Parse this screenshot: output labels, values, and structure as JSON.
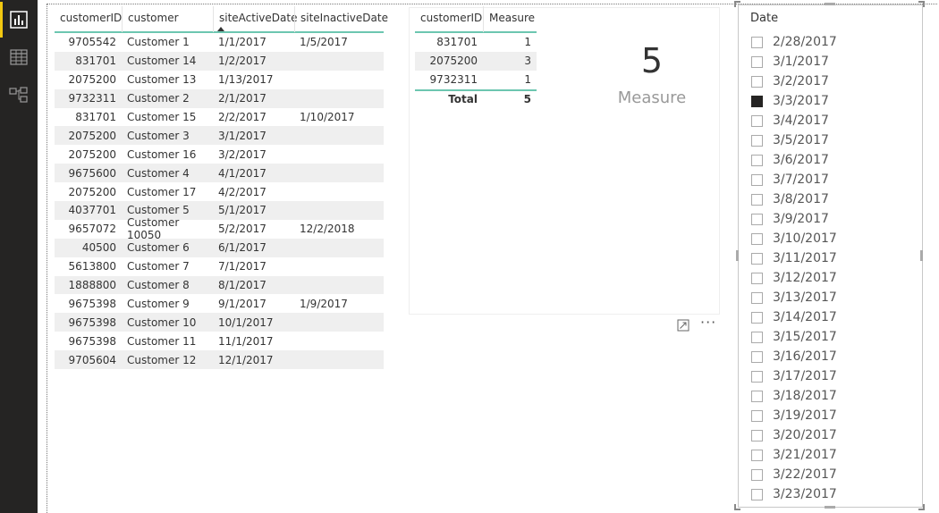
{
  "rail": {
    "items": [
      {
        "name": "report-view-icon",
        "active": true
      },
      {
        "name": "data-view-icon",
        "active": false
      },
      {
        "name": "relationships-view-icon",
        "active": false
      }
    ]
  },
  "table1": {
    "headers": [
      "customerID",
      "customer",
      "siteActiveDate",
      "siteInactiveDate"
    ],
    "rows": [
      [
        "9705542",
        "Customer 1",
        "1/1/2017",
        "1/5/2017"
      ],
      [
        "831701",
        "Customer 14",
        "1/2/2017",
        ""
      ],
      [
        "2075200",
        "Customer 13",
        "1/13/2017",
        ""
      ],
      [
        "9732311",
        "Customer 2",
        "2/1/2017",
        ""
      ],
      [
        "831701",
        "Customer 15",
        "2/2/2017",
        "1/10/2017"
      ],
      [
        "2075200",
        "Customer 3",
        "3/1/2017",
        ""
      ],
      [
        "2075200",
        "Customer 16",
        "3/2/2017",
        ""
      ],
      [
        "9675600",
        "Customer 4",
        "4/1/2017",
        ""
      ],
      [
        "2075200",
        "Customer 17",
        "4/2/2017",
        ""
      ],
      [
        "4037701",
        "Customer 5",
        "5/1/2017",
        ""
      ],
      [
        "9657072",
        "Customer 10050",
        "5/2/2017",
        "12/2/2018"
      ],
      [
        "40500",
        "Customer 6",
        "6/1/2017",
        ""
      ],
      [
        "5613800",
        "Customer 7",
        "7/1/2017",
        ""
      ],
      [
        "1888800",
        "Customer 8",
        "8/1/2017",
        ""
      ],
      [
        "9675398",
        "Customer 9",
        "9/1/2017",
        "1/9/2017"
      ],
      [
        "9675398",
        "Customer 10",
        "10/1/2017",
        ""
      ],
      [
        "9675398",
        "Customer 11",
        "11/1/2017",
        ""
      ],
      [
        "9705604",
        "Customer 12",
        "12/1/2017",
        ""
      ]
    ]
  },
  "table2": {
    "headers": [
      "customerID",
      "Measure"
    ],
    "rows": [
      [
        "831701",
        "1"
      ],
      [
        "2075200",
        "3"
      ],
      [
        "9732311",
        "1"
      ]
    ],
    "total_label": "Total",
    "total_value": "5"
  },
  "card": {
    "value": "5",
    "label": "Measure"
  },
  "panel_icons": {
    "focus": "focus-mode-icon",
    "more": "more-options-icon",
    "more_glyph": "···"
  },
  "slicer": {
    "title": "Date",
    "items": [
      {
        "label": "2/28/2017",
        "checked": false
      },
      {
        "label": "3/1/2017",
        "checked": false
      },
      {
        "label": "3/2/2017",
        "checked": false
      },
      {
        "label": "3/3/2017",
        "checked": true
      },
      {
        "label": "3/4/2017",
        "checked": false
      },
      {
        "label": "3/5/2017",
        "checked": false
      },
      {
        "label": "3/6/2017",
        "checked": false
      },
      {
        "label": "3/7/2017",
        "checked": false
      },
      {
        "label": "3/8/2017",
        "checked": false
      },
      {
        "label": "3/9/2017",
        "checked": false
      },
      {
        "label": "3/10/2017",
        "checked": false
      },
      {
        "label": "3/11/2017",
        "checked": false
      },
      {
        "label": "3/12/2017",
        "checked": false
      },
      {
        "label": "3/13/2017",
        "checked": false
      },
      {
        "label": "3/14/2017",
        "checked": false
      },
      {
        "label": "3/15/2017",
        "checked": false
      },
      {
        "label": "3/16/2017",
        "checked": false
      },
      {
        "label": "3/17/2017",
        "checked": false
      },
      {
        "label": "3/18/2017",
        "checked": false
      },
      {
        "label": "3/19/2017",
        "checked": false
      },
      {
        "label": "3/20/2017",
        "checked": false
      },
      {
        "label": "3/21/2017",
        "checked": false
      },
      {
        "label": "3/22/2017",
        "checked": false
      },
      {
        "label": "3/23/2017",
        "checked": false
      }
    ]
  },
  "colors": {
    "rail_bg": "#252423",
    "active_accent": "#f2c811",
    "header_underline": "#6cc6b0",
    "alt_row": "#efefef"
  }
}
